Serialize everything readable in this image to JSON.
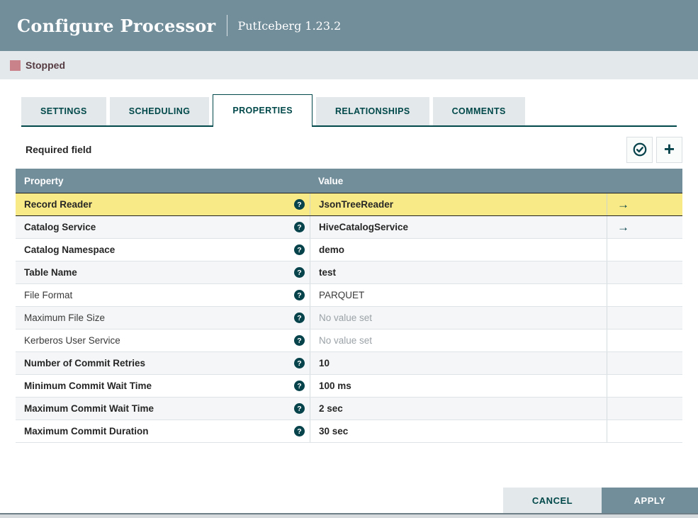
{
  "header": {
    "title": "Configure Processor",
    "subtitle": "PutIceberg 1.23.2"
  },
  "status": {
    "label": "Stopped",
    "color": "#C9828A"
  },
  "tabs": [
    {
      "label": "SETTINGS",
      "active": false
    },
    {
      "label": "SCHEDULING",
      "active": false
    },
    {
      "label": "PROPERTIES",
      "active": true
    },
    {
      "label": "RELATIONSHIPS",
      "active": false
    },
    {
      "label": "COMMENTS",
      "active": false
    }
  ],
  "toolbar": {
    "required_label": "Required field",
    "buttons": [
      {
        "name": "verify-properties",
        "icon": "check-circle-icon"
      },
      {
        "name": "add-property",
        "icon": "plus-icon"
      }
    ]
  },
  "table": {
    "columns": [
      "Property",
      "Value"
    ],
    "rows": [
      {
        "property": "Record Reader",
        "value": "JsonTreeReader",
        "required": true,
        "empty": false,
        "has_arrow": true,
        "selected": true
      },
      {
        "property": "Catalog Service",
        "value": "HiveCatalogService",
        "required": true,
        "empty": false,
        "has_arrow": true,
        "selected": false
      },
      {
        "property": "Catalog Namespace",
        "value": "demo",
        "required": true,
        "empty": false,
        "has_arrow": false,
        "selected": false
      },
      {
        "property": "Table Name",
        "value": "test",
        "required": true,
        "empty": false,
        "has_arrow": false,
        "selected": false
      },
      {
        "property": "File Format",
        "value": "PARQUET",
        "required": false,
        "empty": false,
        "has_arrow": false,
        "selected": false
      },
      {
        "property": "Maximum File Size",
        "value": "No value set",
        "required": false,
        "empty": true,
        "has_arrow": false,
        "selected": false
      },
      {
        "property": "Kerberos User Service",
        "value": "No value set",
        "required": false,
        "empty": true,
        "has_arrow": false,
        "selected": false
      },
      {
        "property": "Number of Commit Retries",
        "value": "10",
        "required": true,
        "empty": false,
        "has_arrow": false,
        "selected": false
      },
      {
        "property": "Minimum Commit Wait Time",
        "value": "100 ms",
        "required": true,
        "empty": false,
        "has_arrow": false,
        "selected": false
      },
      {
        "property": "Maximum Commit Wait Time",
        "value": "2 sec",
        "required": true,
        "empty": false,
        "has_arrow": false,
        "selected": false
      },
      {
        "property": "Maximum Commit Duration",
        "value": "30 sec",
        "required": true,
        "empty": false,
        "has_arrow": false,
        "selected": false
      }
    ],
    "help_glyph": "?",
    "arrow_glyph": "→"
  },
  "footer": {
    "cancel_label": "CANCEL",
    "apply_label": "APPLY"
  },
  "colors": {
    "header_bg": "#728E9B",
    "status_bar_bg": "#E3E8EA",
    "accent_teal": "#004849",
    "selected_row_bg": "#F8EA86",
    "even_row_bg": "#F4F6F7",
    "stopped_square": "#C9828A",
    "apply_button_bg": "#728E9B",
    "cancel_button_bg": "#E3E8EB"
  }
}
